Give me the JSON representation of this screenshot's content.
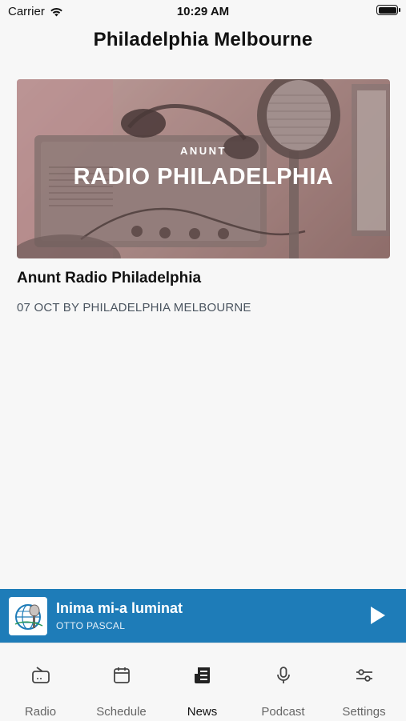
{
  "status_bar": {
    "carrier": "Carrier",
    "time": "10:29 AM",
    "battery_level": 1.0
  },
  "header": {
    "title": "Philadelphia Melbourne"
  },
  "article": {
    "image_kicker": "ANUNT",
    "image_headline": "RADIO PHILADELPHIA",
    "title": "Anunt Radio Philadelphia",
    "meta": "07 OCT BY PHILADELPHIA MELBOURNE"
  },
  "player": {
    "track_title": "Inima mi-a luminat",
    "artist": "OTTO PASCAL",
    "play_icon": "play-icon",
    "background_color": "#1e7cb8"
  },
  "tabs": [
    {
      "label": "Radio",
      "icon": "radio-icon",
      "active": false
    },
    {
      "label": "Schedule",
      "icon": "calendar-icon",
      "active": false
    },
    {
      "label": "News",
      "icon": "news-icon",
      "active": true
    },
    {
      "label": "Podcast",
      "icon": "microphone-icon",
      "active": false
    },
    {
      "label": "Settings",
      "icon": "sliders-icon",
      "active": false
    }
  ]
}
